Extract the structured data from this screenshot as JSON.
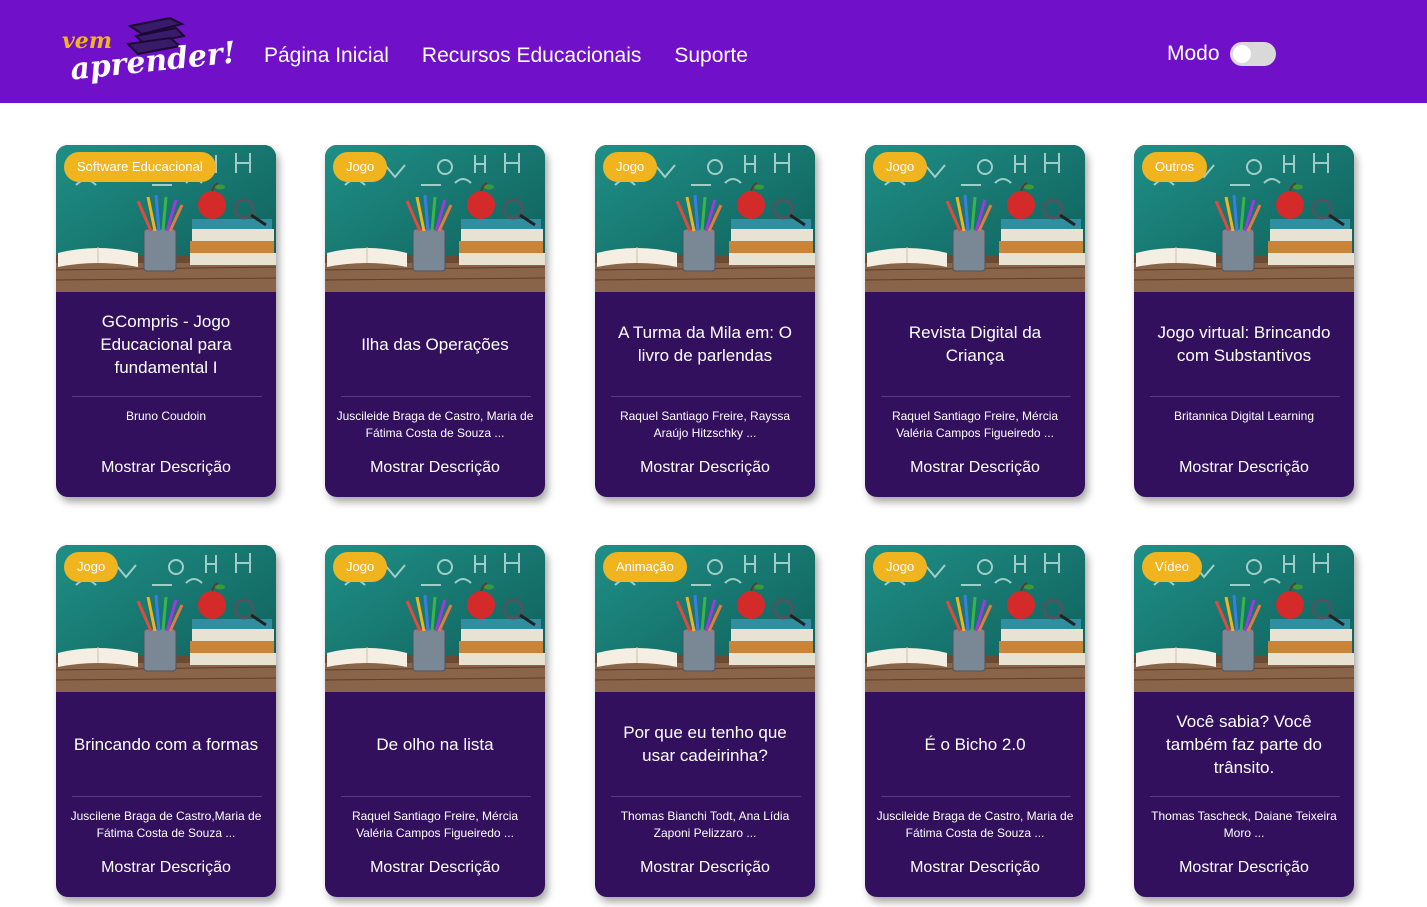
{
  "header": {
    "logo": {
      "top_text": "vem",
      "main_text": "aprender!"
    },
    "nav": [
      {
        "label": "Página Inicial"
      },
      {
        "label": "Recursos Educacionais"
      },
      {
        "label": "Suporte"
      }
    ],
    "mode": {
      "label": "Modo",
      "enabled": false
    }
  },
  "cards": [
    {
      "badge": "Software Educacional",
      "title": "GCompris - Jogo Educacional para fundamental I",
      "authors": "Bruno Coudoin",
      "button": "Mostrar Descrição"
    },
    {
      "badge": "Jogo",
      "title": "Ilha das Operações",
      "authors": "Juscileide Braga de Castro, Maria de Fátima Costa de Souza ...",
      "button": "Mostrar Descrição"
    },
    {
      "badge": "Jogo",
      "title": "A Turma da Mila em: O livro de parlendas",
      "authors": "Raquel Santiago Freire, Rayssa Araújo Hitzschky ...",
      "button": "Mostrar Descrição"
    },
    {
      "badge": "Jogo",
      "title": "Revista Digital da Criança",
      "authors": "Raquel Santiago Freire, Mércia Valéria Campos Figueiredo ...",
      "button": "Mostrar Descrição"
    },
    {
      "badge": "Outros",
      "title": "Jogo virtual: Brincando com Substantivos",
      "authors": "Britannica Digital Learning",
      "button": "Mostrar Descrição"
    },
    {
      "badge": "Jogo",
      "title": "Brincando com a formas",
      "authors": "Juscilene Braga de Castro,Maria de Fátima Costa de Souza ...",
      "button": "Mostrar Descrição"
    },
    {
      "badge": "Jogo",
      "title": "De olho na lista",
      "authors": "Raquel Santiago Freire, Mércia Valéria Campos Figueiredo ...",
      "button": "Mostrar Descrição"
    },
    {
      "badge": "Animação",
      "title": "Por que eu tenho que usar cadeirinha?",
      "authors": "Thomas Bianchi Todt, Ana Lídia Zaponi Pelizzaro ...",
      "button": "Mostrar Descrição"
    },
    {
      "badge": "Jogo",
      "title": "É o Bicho 2.0",
      "authors": "Juscileide Braga de Castro, Maria de Fátima Costa de Souza ...",
      "button": "Mostrar Descrição"
    },
    {
      "badge": "Vídeo",
      "title": "Você sabia? Você também faz parte do trânsito.",
      "authors": "Thomas Tascheck, Daiane Teixeira Moro ...",
      "button": "Mostrar Descrição"
    }
  ],
  "colors": {
    "header_bg": "#7010c8",
    "card_bg": "#32105e",
    "badge_bg": "#f0b41e"
  }
}
